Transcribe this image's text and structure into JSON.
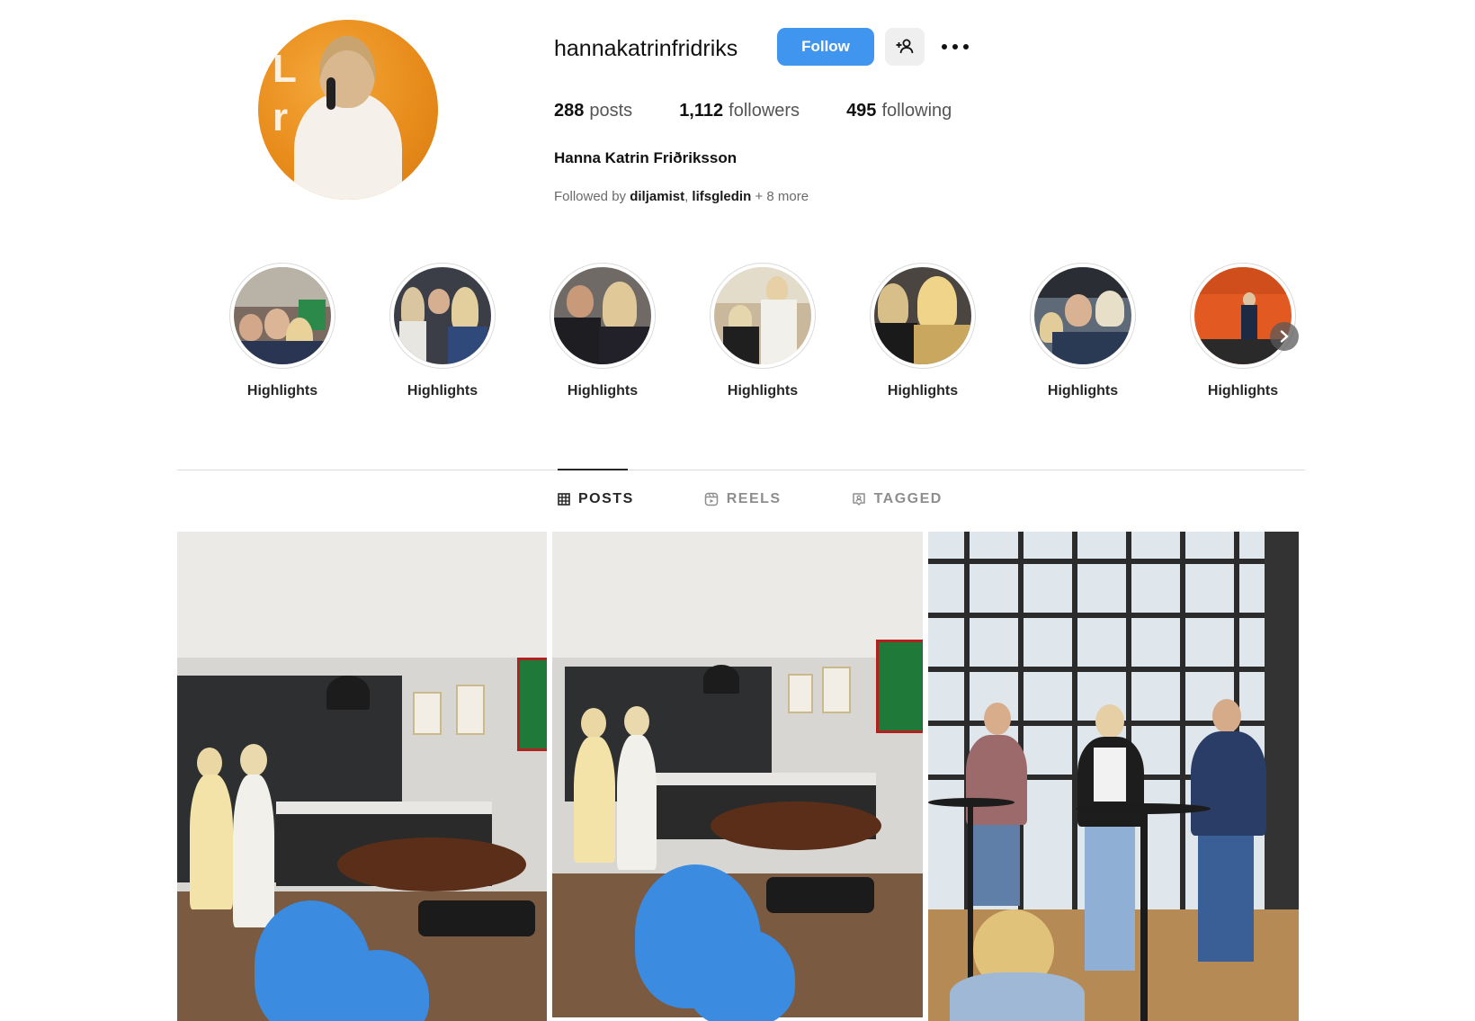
{
  "profile": {
    "username": "hannakatrinfridriks",
    "follow_label": "Follow",
    "avatar_text_line1": "L",
    "avatar_text_line2": "r",
    "full_name": "Hanna Katrin Friðriksson",
    "stats": {
      "posts_count": "288",
      "posts_label": "posts",
      "followers_count": "1,112",
      "followers_label": "followers",
      "following_count": "495",
      "following_label": "following"
    },
    "followed_by": {
      "prefix": "Followed by",
      "user1": "diljamist",
      "separator": ",",
      "user2": "lifsgledin",
      "more": "+ 8 more"
    }
  },
  "highlights": [
    {
      "label": "Highlights"
    },
    {
      "label": "Highlights"
    },
    {
      "label": "Highlights"
    },
    {
      "label": "Highlights"
    },
    {
      "label": "Highlights"
    },
    {
      "label": "Highlights"
    },
    {
      "label": "Highlights"
    }
  ],
  "tabs": {
    "posts": "POSTS",
    "reels": "REELS",
    "tagged": "TAGGED",
    "active": "posts"
  },
  "colors": {
    "follow_button": "#4096ee",
    "text_primary": "#262626",
    "text_secondary": "#8e8e8e"
  },
  "icons": {
    "suggest": "person-add-icon",
    "more": "more-horizontal-icon",
    "next": "chevron-right-icon",
    "posts_tab": "grid-icon",
    "reels_tab": "reels-icon",
    "tagged_tab": "tagged-icon"
  }
}
